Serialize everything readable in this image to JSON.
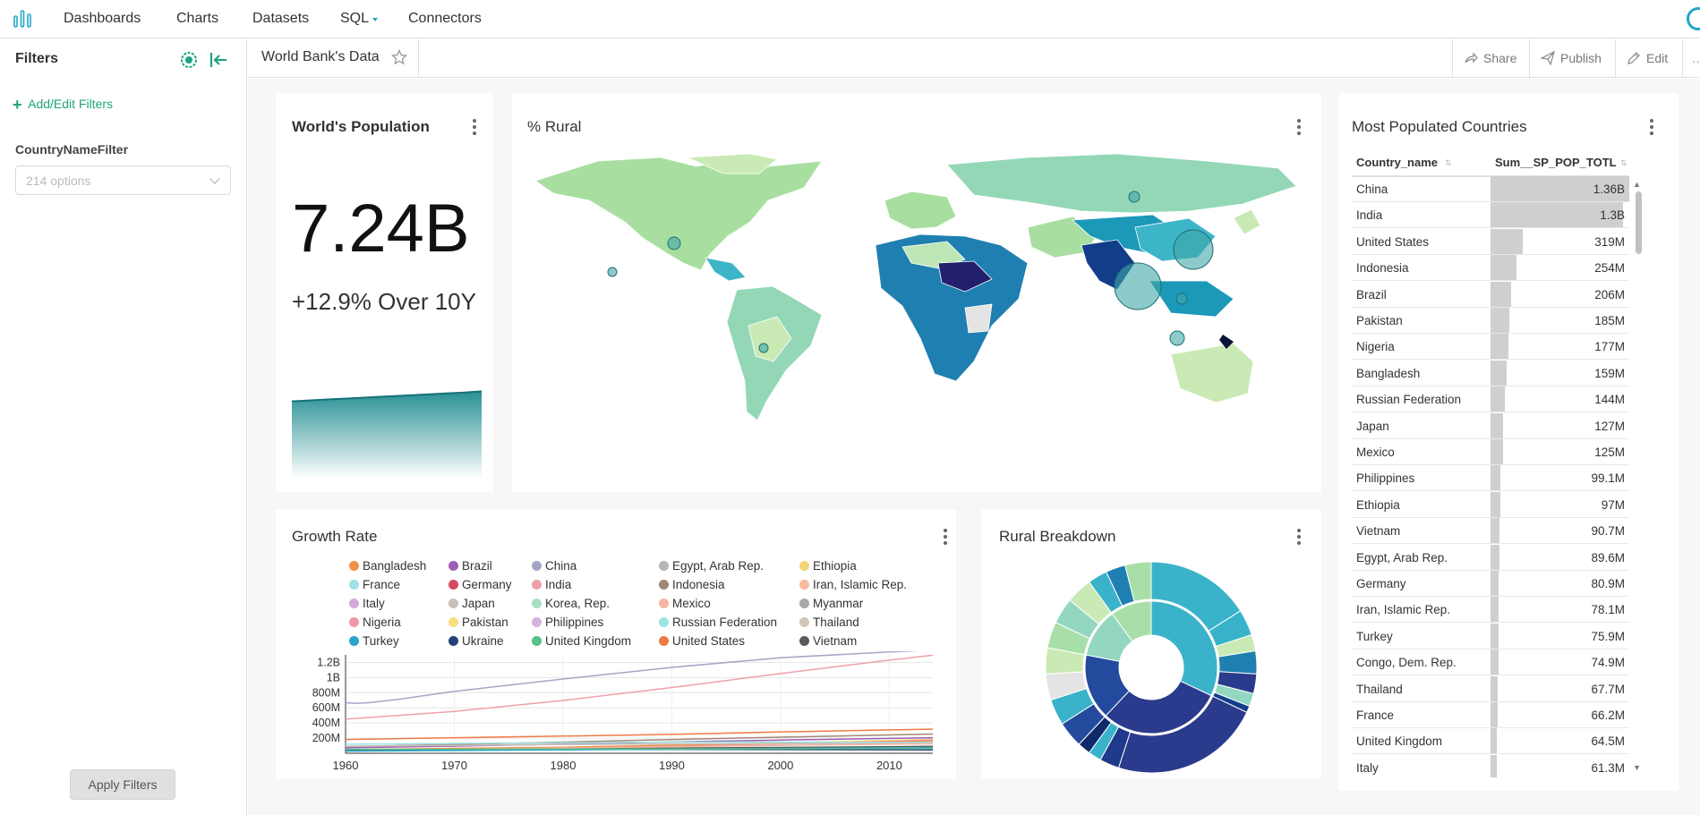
{
  "nav": {
    "items": [
      {
        "label": "Dashboards"
      },
      {
        "label": "Charts"
      },
      {
        "label": "Datasets"
      },
      {
        "label": "SQL"
      },
      {
        "label": "Connectors"
      }
    ]
  },
  "sidebar": {
    "title": "Filters",
    "add_label": "Add/Edit Filters",
    "filter_name": "CountryNameFilter",
    "filter_placeholder": "214 options",
    "apply_label": "Apply Filters"
  },
  "dashboard": {
    "title": "World Bank's Data",
    "actions": [
      {
        "label": "Share",
        "icon": "share-icon"
      },
      {
        "label": "Publish",
        "icon": "publish-icon"
      },
      {
        "label": "Edit",
        "icon": "edit-icon"
      }
    ],
    "more": "..."
  },
  "colors": {
    "accent": "#20a7c9",
    "green": "#1fa37e",
    "teal_trend": "#1c8a8e"
  },
  "cards": {
    "population": {
      "title": "World's Population",
      "big_number": "7.24B",
      "subheader": "+12.9% Over 10Y"
    },
    "rural": {
      "title": "% Rural"
    },
    "growth": {
      "title": "Growth Rate"
    },
    "breakdown": {
      "title": "Rural Breakdown"
    },
    "countries": {
      "title": "Most Populated Countries"
    }
  },
  "table": {
    "columns": [
      "Country_name",
      "Sum__SP_POP_TOTL"
    ],
    "max_value": 1.36,
    "rows": [
      {
        "name": "China",
        "value": "1.36B",
        "num": 1.36
      },
      {
        "name": "India",
        "value": "1.3B",
        "num": 1.3
      },
      {
        "name": "United States",
        "value": "319M",
        "num": 0.319
      },
      {
        "name": "Indonesia",
        "value": "254M",
        "num": 0.254
      },
      {
        "name": "Brazil",
        "value": "206M",
        "num": 0.206
      },
      {
        "name": "Pakistan",
        "value": "185M",
        "num": 0.185
      },
      {
        "name": "Nigeria",
        "value": "177M",
        "num": 0.177
      },
      {
        "name": "Bangladesh",
        "value": "159M",
        "num": 0.159
      },
      {
        "name": "Russian Federation",
        "value": "144M",
        "num": 0.144
      },
      {
        "name": "Japan",
        "value": "127M",
        "num": 0.127
      },
      {
        "name": "Mexico",
        "value": "125M",
        "num": 0.125
      },
      {
        "name": "Philippines",
        "value": "99.1M",
        "num": 0.0991
      },
      {
        "name": "Ethiopia",
        "value": "97M",
        "num": 0.097
      },
      {
        "name": "Vietnam",
        "value": "90.7M",
        "num": 0.0907
      },
      {
        "name": "Egypt, Arab Rep.",
        "value": "89.6M",
        "num": 0.0896
      },
      {
        "name": "Germany",
        "value": "80.9M",
        "num": 0.0809
      },
      {
        "name": "Iran, Islamic Rep.",
        "value": "78.1M",
        "num": 0.0781
      },
      {
        "name": "Turkey",
        "value": "75.9M",
        "num": 0.0759
      },
      {
        "name": "Congo, Dem. Rep.",
        "value": "74.9M",
        "num": 0.0749
      },
      {
        "name": "Thailand",
        "value": "67.7M",
        "num": 0.0677
      },
      {
        "name": "France",
        "value": "66.2M",
        "num": 0.0662
      },
      {
        "name": "United Kingdom",
        "value": "64.5M",
        "num": 0.0645
      },
      {
        "name": "Italy",
        "value": "61.3M",
        "num": 0.0613
      }
    ]
  },
  "chart_data": [
    {
      "type": "line",
      "title": "Growth Rate",
      "x": [
        1960,
        1970,
        1980,
        1990,
        2000,
        2010
      ],
      "xlim": [
        1960,
        2014
      ],
      "ylim": [
        0,
        1300000000
      ],
      "ytick_labels": [
        "200M",
        "400M",
        "600M",
        "800M",
        "1B",
        "1.2B"
      ],
      "xtick_labels": [
        "1960",
        "1970",
        "1980",
        "1990",
        "2000",
        "2010"
      ],
      "legend": [
        {
          "name": "Bangladesh",
          "color": "#f28e4c"
        },
        {
          "name": "Brazil",
          "color": "#9b5fb5"
        },
        {
          "name": "China",
          "color": "#a5a5c8"
        },
        {
          "name": "Egypt, Arab Rep.",
          "color": "#b5b5b5"
        },
        {
          "name": "Ethiopia",
          "color": "#f5d57a"
        },
        {
          "name": "France",
          "color": "#9fe0e6"
        },
        {
          "name": "Germany",
          "color": "#d64a5f"
        },
        {
          "name": "India",
          "color": "#f0a0ab"
        },
        {
          "name": "Indonesia",
          "color": "#a08774"
        },
        {
          "name": "Iran, Islamic Rep.",
          "color": "#f7bc9e"
        },
        {
          "name": "Italy",
          "color": "#d5a9dc"
        },
        {
          "name": "Japan",
          "color": "#c8bfb8"
        },
        {
          "name": "Korea, Rep.",
          "color": "#a9dec2"
        },
        {
          "name": "Mexico",
          "color": "#f4b5a4"
        },
        {
          "name": "Myanmar",
          "color": "#a8a8a8"
        },
        {
          "name": "Nigeria",
          "color": "#ee9aa6"
        },
        {
          "name": "Pakistan",
          "color": "#f7e080"
        },
        {
          "name": "Philippines",
          "color": "#d7b3e0"
        },
        {
          "name": "Russian Federation",
          "color": "#9ee3e3"
        },
        {
          "name": "Thailand",
          "color": "#d3c5b8"
        },
        {
          "name": "Turkey",
          "color": "#2aa4cc"
        },
        {
          "name": "Ukraine",
          "color": "#283e77"
        },
        {
          "name": "United Kingdom",
          "color": "#56c18a"
        },
        {
          "name": "United States",
          "color": "#ef7a45"
        },
        {
          "name": "Vietnam",
          "color": "#5a5a5a"
        }
      ],
      "series": [
        {
          "name": "China",
          "x": [
            1960,
            1961,
            1962,
            1965,
            1970,
            1980,
            1990,
            2000,
            2010,
            2014
          ],
          "values": [
            667000000,
            660000000,
            666000000,
            715000000,
            818000000,
            981000000,
            1135000000,
            1262000000,
            1338000000,
            1364000000
          ]
        },
        {
          "name": "India",
          "x": [
            1960,
            1970,
            1980,
            1990,
            2000,
            2010,
            2014
          ],
          "values": [
            450000000,
            553000000,
            697000000,
            868000000,
            1053000000,
            1231000000,
            1295000000
          ]
        },
        {
          "name": "United States",
          "x": [
            1960,
            1970,
            1980,
            1990,
            2000,
            2010,
            2014
          ],
          "values": [
            181000000,
            205000000,
            227000000,
            250000000,
            282000000,
            309000000,
            319000000
          ]
        },
        {
          "name": "Indonesia",
          "x": [
            1960,
            1970,
            1980,
            1990,
            2000,
            2010,
            2014
          ],
          "values": [
            88000000,
            115000000,
            147000000,
            181000000,
            212000000,
            242000000,
            254000000
          ]
        },
        {
          "name": "Brazil",
          "x": [
            1960,
            1970,
            1980,
            1990,
            2000,
            2010,
            2014
          ],
          "values": [
            72000000,
            95000000,
            121000000,
            149000000,
            175000000,
            196000000,
            206000000
          ]
        },
        {
          "name": "Pakistan",
          "x": [
            1960,
            1970,
            1980,
            1990,
            2000,
            2010,
            2014
          ],
          "values": [
            44000000,
            58000000,
            78000000,
            107000000,
            138000000,
            170000000,
            185000000
          ]
        },
        {
          "name": "Nigeria",
          "x": [
            1960,
            1970,
            1980,
            1990,
            2000,
            2010,
            2014
          ],
          "values": [
            45000000,
            56000000,
            73000000,
            95000000,
            122000000,
            158000000,
            177000000
          ]
        },
        {
          "name": "Bangladesh",
          "x": [
            1960,
            1970,
            1980,
            1990,
            2000,
            2010,
            2014
          ],
          "values": [
            48000000,
            65000000,
            80000000,
            106000000,
            131000000,
            151000000,
            159000000
          ]
        },
        {
          "name": "Russian Federation",
          "x": [
            1960,
            1970,
            1980,
            1990,
            2000,
            2010,
            2014
          ],
          "values": [
            120000000,
            130000000,
            139000000,
            148000000,
            147000000,
            143000000,
            144000000
          ]
        },
        {
          "name": "Japan",
          "x": [
            1960,
            1970,
            1980,
            1990,
            2000,
            2010,
            2014
          ],
          "values": [
            93000000,
            104000000,
            117000000,
            124000000,
            127000000,
            128000000,
            127000000
          ]
        },
        {
          "name": "Mexico",
          "x": [
            1960,
            1970,
            1980,
            1990,
            2000,
            2010,
            2014
          ],
          "values": [
            38000000,
            52000000,
            69000000,
            87000000,
            104000000,
            119000000,
            125000000
          ]
        },
        {
          "name": "Ukraine",
          "x": [
            1960,
            1990,
            2014
          ],
          "values": [
            42000000,
            52000000,
            45000000
          ]
        },
        {
          "name": "Vietnam",
          "x": [
            1960,
            1990,
            2014
          ],
          "values": [
            32000000,
            68000000,
            91000000
          ]
        },
        {
          "name": "Turkey",
          "x": [
            1960,
            1990,
            2014
          ],
          "values": [
            28000000,
            54000000,
            76000000
          ]
        },
        {
          "name": "United Kingdom",
          "x": [
            1960,
            1990,
            2014
          ],
          "values": [
            52000000,
            57000000,
            65000000
          ]
        }
      ]
    },
    {
      "type": "sunburst",
      "title": "Rural Breakdown"
    },
    {
      "type": "area",
      "title": "World's Population",
      "values": [
        6.41,
        6.49,
        6.57,
        6.65,
        6.73,
        6.81,
        6.89,
        6.97,
        7.05,
        7.13,
        7.24
      ]
    }
  ]
}
